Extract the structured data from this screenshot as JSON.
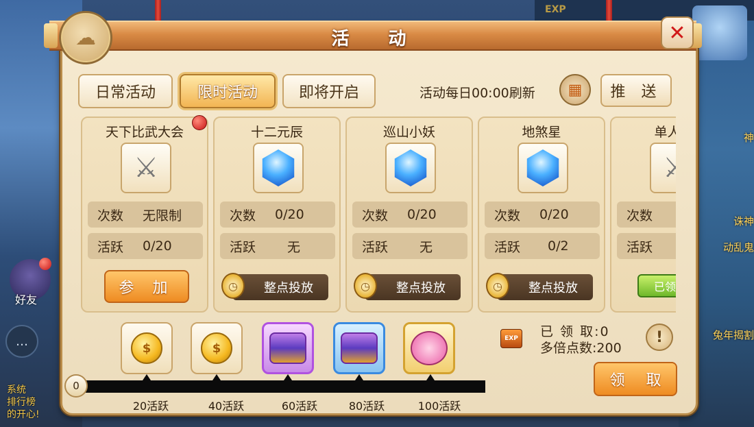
{
  "hud": {
    "exp_label": "EXP",
    "friend_label": "好友",
    "chat_icon": "chat-bubble-icon",
    "side_lines": [
      "系统",
      "排行榜",
      "的开心!"
    ],
    "right_lines": [
      "神",
      "诛神",
      "动乱鬼",
      "兔年揭割"
    ]
  },
  "window": {
    "title": "活 动",
    "close_icon": "close-icon"
  },
  "tabs": [
    {
      "label": "日常活动",
      "active": false
    },
    {
      "label": "限时活动",
      "active": true
    },
    {
      "label": "即将开启",
      "active": false
    }
  ],
  "refresh_text": "活动每日00:00刷新",
  "push_label": "推 送",
  "cards": [
    {
      "title": "天下比武大会",
      "icon": "crossed-swords-icon",
      "count_label": "次数",
      "count_value": "无限制",
      "active_label": "活跃",
      "active_value": "0/20",
      "action": "参 加",
      "action_type": "join",
      "has_dot": true
    },
    {
      "title": "十二元辰",
      "icon": "blue-gem-icon",
      "count_label": "次数",
      "count_value": "0/20",
      "active_label": "活跃",
      "active_value": "无",
      "action": "整点投放",
      "action_type": "hourly"
    },
    {
      "title": "巡山小妖",
      "icon": "blue-gem-icon",
      "count_label": "次数",
      "count_value": "0/20",
      "active_label": "活跃",
      "active_value": "无",
      "action": "整点投放",
      "action_type": "hourly"
    },
    {
      "title": "地煞星",
      "icon": "blue-gem-icon",
      "count_label": "次数",
      "count_value": "0/20",
      "active_label": "活跃",
      "active_value": "0/2",
      "action": "整点投放",
      "action_type": "hourly"
    },
    {
      "title": "单人竞",
      "icon": "crossed-swords-icon",
      "count_label": "次数",
      "count_value": "",
      "active_label": "活跃",
      "active_value": "",
      "action": "已领",
      "action_type": "claimed"
    }
  ],
  "rewards": {
    "progress_value": "0",
    "milestones": [
      {
        "label": "20活跃",
        "icon": "gold-coin-icon",
        "frame": "plain"
      },
      {
        "label": "40活跃",
        "icon": "gold-coin-icon",
        "frame": "plain"
      },
      {
        "label": "60活跃",
        "icon": "treasure-chest-icon",
        "frame": "purple"
      },
      {
        "label": "80活跃",
        "icon": "treasure-chest-icon",
        "frame": "blue"
      },
      {
        "label": "100活跃",
        "icon": "pig-bag-icon",
        "frame": "gold"
      }
    ],
    "exp_badge": "EXP",
    "claimed_text": "已 领 取:0",
    "multiplier_text": "多倍点数:200",
    "info_icon": "info-exclamation-icon",
    "claim_label": "领 取"
  },
  "colors": {
    "active_tab": "#f2b553",
    "orange_button": "#ee8b22",
    "panel_bg": "#f6ead0"
  }
}
